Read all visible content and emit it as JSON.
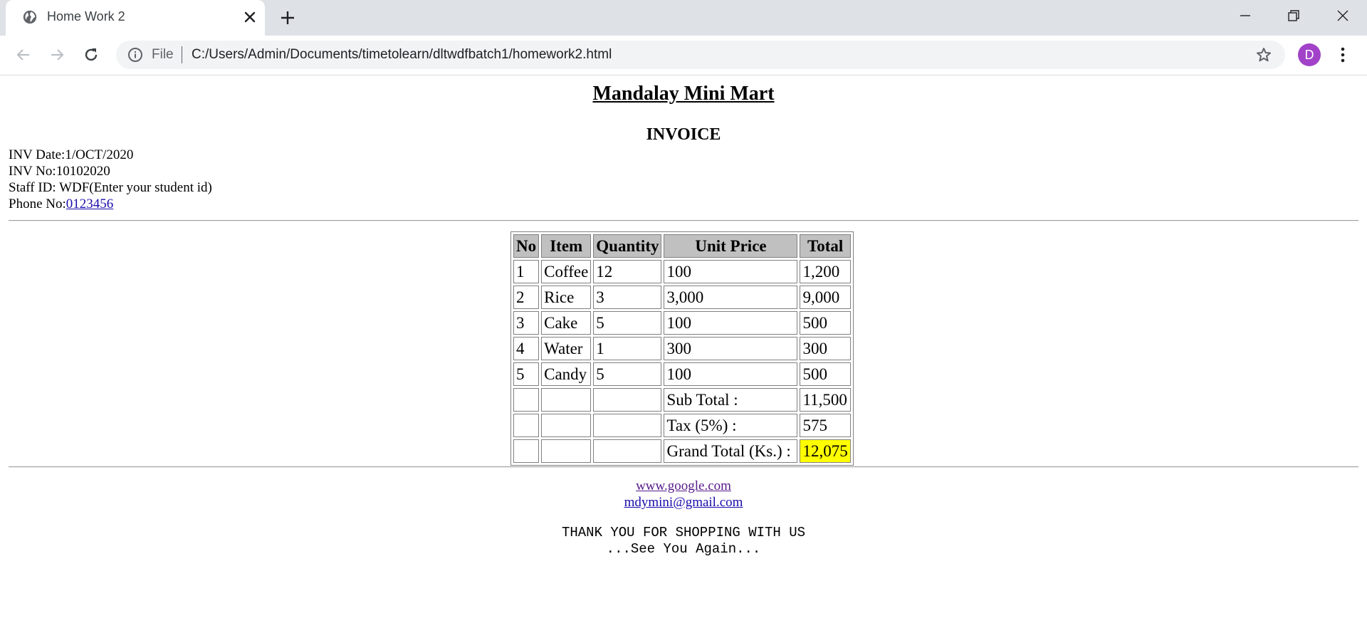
{
  "browser": {
    "tab": {
      "title": "Home Work 2"
    },
    "address": {
      "scheme_label": "File",
      "url": "C:/Users/Admin/Documents/timetolearn/dltwdfbatch1/homework2.html"
    },
    "profile": {
      "initial": "D"
    },
    "colors": {
      "tabbar": "#dee1e6",
      "omnibox": "#f1f3f4",
      "avatar": "#a142c9"
    }
  },
  "page": {
    "shop_name": "Mandalay Mini Mart",
    "doc_title": "INVOICE",
    "meta": {
      "date_label": "INV Date:",
      "date_value": "1/OCT/2020",
      "no_label": "INV No:",
      "no_value": "10102020",
      "staff_label": "Staff ID: ",
      "staff_value": "WDF(Enter your student id)",
      "phone_label": "Phone No:",
      "phone_value": "0123456"
    },
    "table": {
      "headers": [
        "No",
        "Item",
        "Quantity",
        "Unit Price",
        "Total"
      ],
      "rows": [
        [
          "1",
          "Coffee",
          "12",
          "100",
          "1,200"
        ],
        [
          "2",
          "Rice",
          "3",
          "3,000",
          "9,000"
        ],
        [
          "3",
          "Cake",
          "5",
          "100",
          "500"
        ],
        [
          "4",
          "Water",
          "1",
          "300",
          "300"
        ],
        [
          "5",
          "Candy",
          "5",
          "100",
          "500"
        ]
      ],
      "summary": [
        {
          "label": "Sub Total :",
          "value": "11,500"
        },
        {
          "label": "Tax (5%) :",
          "value": "575"
        },
        {
          "label": "Grand Total (Ks.) :",
          "value": "12,075"
        }
      ],
      "highlight_color": "#ffff00"
    },
    "footer": {
      "website": "www.google.com",
      "email": "mdymini@gmail.com",
      "thanks_line1": "THANK YOU FOR SHOPPING WITH US",
      "thanks_line2": "...See You Again..."
    }
  }
}
